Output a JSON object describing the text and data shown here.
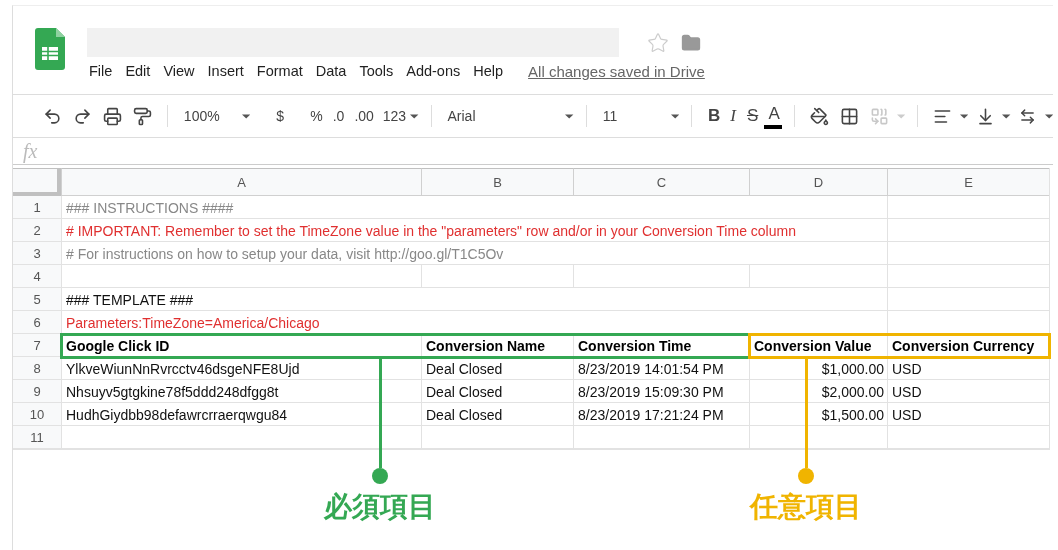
{
  "menu": [
    "File",
    "Edit",
    "View",
    "Insert",
    "Format",
    "Data",
    "Tools",
    "Add-ons",
    "Help"
  ],
  "save_status": "All changes saved in Drive",
  "toolbar": {
    "zoom": "100%",
    "currency": "$",
    "percent": "%",
    "decrease_decimals": ".0",
    "increase_decimals": ".00",
    "number_format": "123",
    "font": "Arial",
    "font_size": "11",
    "bold": "B",
    "italic": "I",
    "strikethrough": "S",
    "text_color": "A",
    "merge_disabled": true
  },
  "formula_bar": {
    "label": "fx"
  },
  "rows": [
    {
      "number": "1",
      "kind": "comment",
      "cells": [
        "### INSTRUCTIONS ####"
      ]
    },
    {
      "number": "2",
      "kind": "important",
      "cells": [
        "# IMPORTANT: Remember to set the TimeZone value in the \"parameters\" row and/or in your Conversion Time column"
      ]
    },
    {
      "number": "3",
      "kind": "comment",
      "cells": [
        "# For instructions on how to setup your data, visit http://goo.gl/T1C5Ov"
      ]
    },
    {
      "number": "4",
      "kind": "plain"
    },
    {
      "number": "5",
      "kind": "plain",
      "cells": [
        "### TEMPLATE ###"
      ]
    },
    {
      "number": "6",
      "kind": "important",
      "cells": [
        "Parameters:TimeZone=America/Chicago"
      ]
    },
    {
      "number": "7",
      "kind": "header",
      "cells": [
        "Google Click ID",
        "Conversion Name",
        "Conversion Time",
        "Conversion Value",
        "Conversion Currency"
      ]
    },
    {
      "number": "8",
      "kind": "plain",
      "cells": [
        "YlkveWiunNnRvrcctv46dsgeNFE8Ujd",
        "Deal Closed",
        "8/23/2019 14:01:54 PM",
        "$1,000.00",
        "USD"
      ]
    },
    {
      "number": "9",
      "kind": "plain",
      "cells": [
        "Nhsuyv5gtgkine78f5ddd248dfgg8t",
        "Deal Closed",
        "8/23/2019 15:09:30 PM",
        "$2,000.00",
        "USD"
      ]
    },
    {
      "number": "10",
      "kind": "plain",
      "cells": [
        "HudhGiydbb98defawrcrraerqwgu84",
        "Deal Closed",
        "8/23/2019 17:21:24 PM",
        "$1,500.00",
        "USD"
      ]
    },
    {
      "number": "11",
      "kind": "plain"
    }
  ],
  "highlights": [
    {
      "label": "必須項目",
      "color": "#34a853",
      "columns": [
        {
          "letter": "A"
        },
        {
          "letter": "B"
        },
        {
          "letter": "C"
        }
      ]
    },
    {
      "label": "任意項目",
      "color": "#f0b400",
      "columns": [
        {
          "letter": "D",
          "right_aligned": true
        },
        {
          "letter": "E"
        }
      ]
    }
  ]
}
